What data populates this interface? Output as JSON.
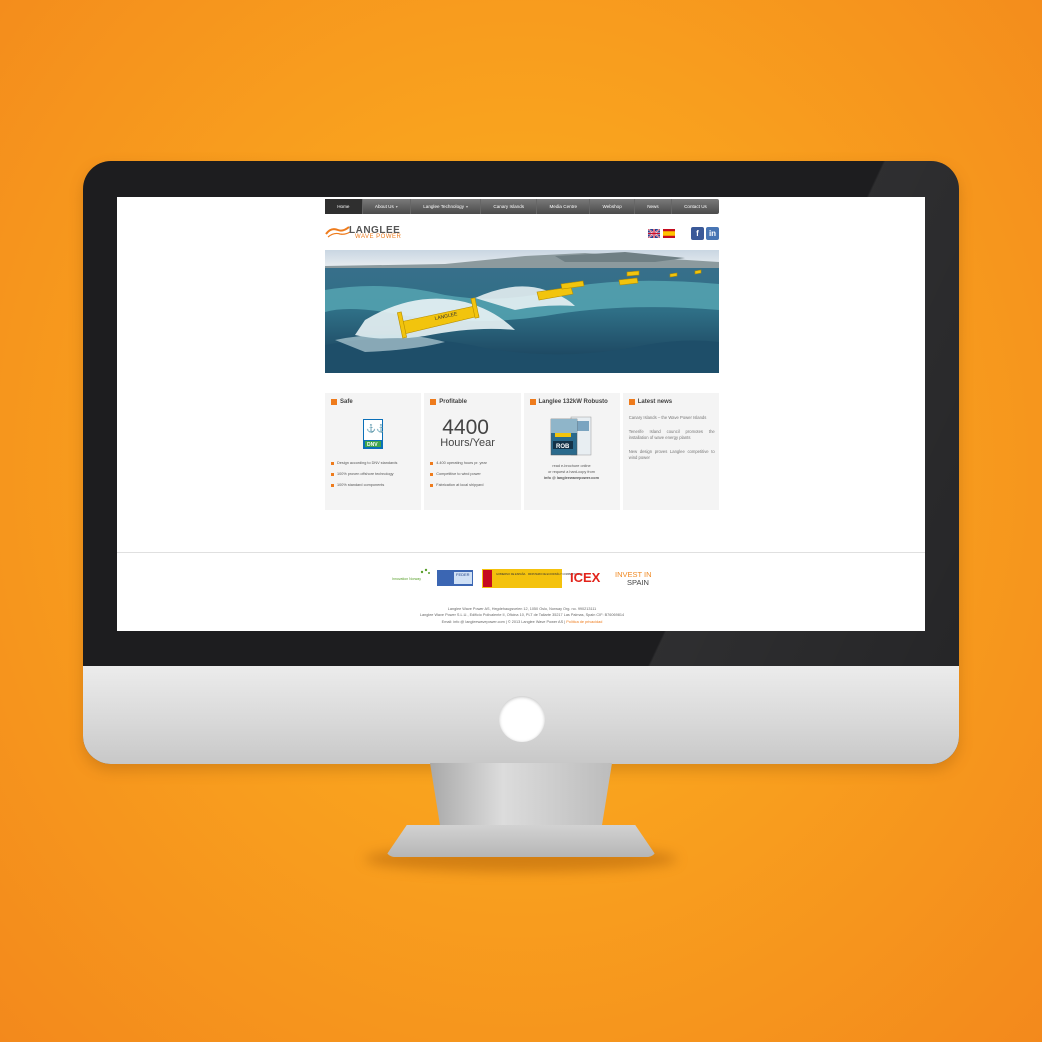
{
  "site": {
    "nav": [
      {
        "label": "Home",
        "active": true,
        "caret": false
      },
      {
        "label": "About Us",
        "active": false,
        "caret": true
      },
      {
        "label": "Langlee Technology",
        "active": false,
        "caret": true
      },
      {
        "label": "Canary Islands",
        "active": false,
        "caret": false
      },
      {
        "label": "Media Centre",
        "active": false,
        "caret": false
      },
      {
        "label": "Webshop",
        "active": false,
        "caret": false
      },
      {
        "label": "News",
        "active": false,
        "caret": false
      },
      {
        "label": "Contact Us",
        "active": false,
        "caret": false
      }
    ],
    "logo": {
      "name": "LANGLEE",
      "tagline": "WAVE POWER"
    },
    "languages": [
      "english-flag",
      "spanish-flag"
    ],
    "social": [
      "facebook-icon",
      "linkedin-icon"
    ],
    "boxes": {
      "safe": {
        "title": "Safe",
        "badge": "DNV",
        "items": [
          "Design according to DNV standards",
          "100% proven offshore technology",
          "100% standard components"
        ]
      },
      "profitable": {
        "title": "Profitable",
        "big_number": "4400",
        "big_unit": "Hours/Year",
        "items": [
          "4.400 operating hours pr. year",
          "Competitive to wind power",
          "Fabrication at local shipyard"
        ]
      },
      "robusto": {
        "title": "Langlee 132kW Robusto",
        "text_line1": "read e-brochure online",
        "text_line2": "or request a hard-copy from",
        "email": "info @ langleewavepower.com"
      },
      "news": {
        "title": "Latest news",
        "items": [
          "Canary Islands – the Wave Power Islands",
          "Tenerife Island council promotes the installation of wave energy plants",
          "New design proves Langlee competitive to wind power"
        ]
      }
    },
    "partners": {
      "innovation_norway": "Innovation Norway",
      "feder": "FEDER",
      "gobierno": "GOBIERNO DE ESPAÑA",
      "ministerio": "MINISTERIO DE ECONOMÍA Y COMPETITIVIDAD",
      "icex": "ICEX",
      "invest_in": "INVEST IN",
      "spain": "SPAIN"
    },
    "footer": {
      "line1": "Langlee Wave Power AS, Hegdehaugsveien 12, 1050 Oslo, Norway   Org. no. 990213111",
      "line2": "Langlee Wave Power S.L.U., Edificio Polivalente II, Oficina 10, PLT de Taliarte 35217 Las Palmas, Spain   CIF: B76069814",
      "line3": "Email: info @ langleewavepower.com  |  © 2013 Langlee Wave Power AS  |",
      "privacy": "Política de privacidad"
    }
  }
}
